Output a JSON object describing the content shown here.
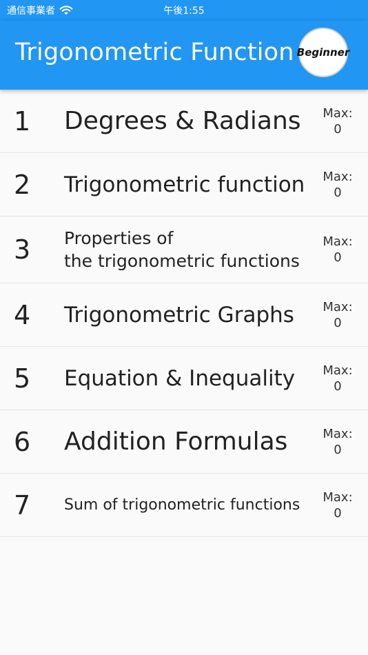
{
  "status_bar": {
    "carrier": "通信事業者",
    "time": "午後1:55"
  },
  "app_bar": {
    "title": "Trigonometric Function",
    "level_badge": "Beginner"
  },
  "lessons": [
    {
      "number": "1",
      "title": "Degrees & Radians",
      "max_label": "Max:",
      "max_value": "0"
    },
    {
      "number": "2",
      "title": "Trigonometric function",
      "max_label": "Max:",
      "max_value": "0"
    },
    {
      "number": "3",
      "title_line1": "Properties of",
      "title_line2": "the trigonometric functions",
      "max_label": "Max:",
      "max_value": "0"
    },
    {
      "number": "4",
      "title": "Trigonometric Graphs",
      "max_label": "Max:",
      "max_value": "0"
    },
    {
      "number": "5",
      "title": "Equation & Inequality",
      "max_label": "Max:",
      "max_value": "0"
    },
    {
      "number": "6",
      "title": "Addition Formulas",
      "max_label": "Max:",
      "max_value": "0"
    },
    {
      "number": "7",
      "title": "Sum of trigonometric functions",
      "max_label": "Max:",
      "max_value": "0"
    }
  ],
  "icons": {
    "wifi": "wifi-icon"
  },
  "colors": {
    "primary": "#2196f3",
    "background": "#fafafa",
    "divider": "#e6e6e6"
  }
}
